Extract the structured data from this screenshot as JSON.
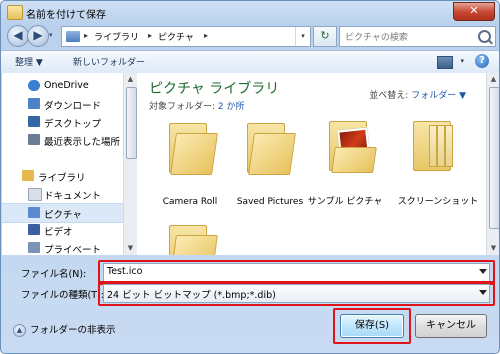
{
  "window": {
    "title": "名前を付けて保存",
    "close": "✕"
  },
  "nav": {
    "back": "◀",
    "forward": "▶",
    "history": "▾",
    "breadcrumb": [
      "ライブラリ",
      "ピクチャ"
    ],
    "crumb_sep": "▸",
    "address_dropdown": "▾",
    "refresh": "↻",
    "search_placeholder": "ピクチャの検索"
  },
  "toolbar": {
    "organize": "整理 ▼",
    "new_folder": "新しいフォルダー",
    "view_dd": "▾",
    "help": "?"
  },
  "sidebar": {
    "items": [
      {
        "label": "OneDrive",
        "icon": "cloud-icon",
        "color": "#3a7fd0"
      },
      {
        "label": "ダウンロード",
        "icon": "download-icon",
        "color": "#4b82c8"
      },
      {
        "label": "デスクトップ",
        "icon": "desktop-icon",
        "color": "#3566a8"
      },
      {
        "label": "最近表示した場所",
        "icon": "recent-places-icon",
        "color": "#6a7d95"
      },
      {
        "label": "ライブラリ",
        "icon": "library-icon",
        "color": "#e5b84b"
      },
      {
        "label": "ドキュメント",
        "icon": "documents-icon",
        "color": "#d9dfe8"
      },
      {
        "label": "ピクチャ",
        "icon": "pictures-icon",
        "color": "#5a8ad0"
      },
      {
        "label": "ビデオ",
        "icon": "videos-icon",
        "color": "#3d5fa0"
      },
      {
        "label": "プライベート",
        "icon": "private-icon",
        "color": "#7b93b5"
      }
    ],
    "scroll_up": "▲",
    "scroll_down": "▼"
  },
  "library": {
    "title": "ピクチャ ライブラリ",
    "target_label": "対象フォルダー:",
    "target_value": "2 か所",
    "sort_label": "並べ替え:",
    "sort_value": "フォルダー ▼",
    "folders": [
      {
        "name": "Camera Roll"
      },
      {
        "name": "Saved Pictures"
      },
      {
        "name": "サンプル ピクチャ"
      },
      {
        "name": "スクリーンショット"
      },
      {
        "name": ""
      }
    ]
  },
  "form": {
    "filename_label": "ファイル名(N):",
    "filename_value": "Test.ico",
    "filetype_label": "ファイルの種類(T):",
    "filetype_value": "24 ビット ビットマップ (*.bmp;*.dib)"
  },
  "footer": {
    "hide_folders": "フォルダーの非表示",
    "hide_icon": "▲",
    "save": "保存(S)",
    "cancel": "キャンセル"
  },
  "colors": {
    "highlight": "#e0121a",
    "library_title": "#1f6a2e",
    "link": "#1e5aa8"
  }
}
